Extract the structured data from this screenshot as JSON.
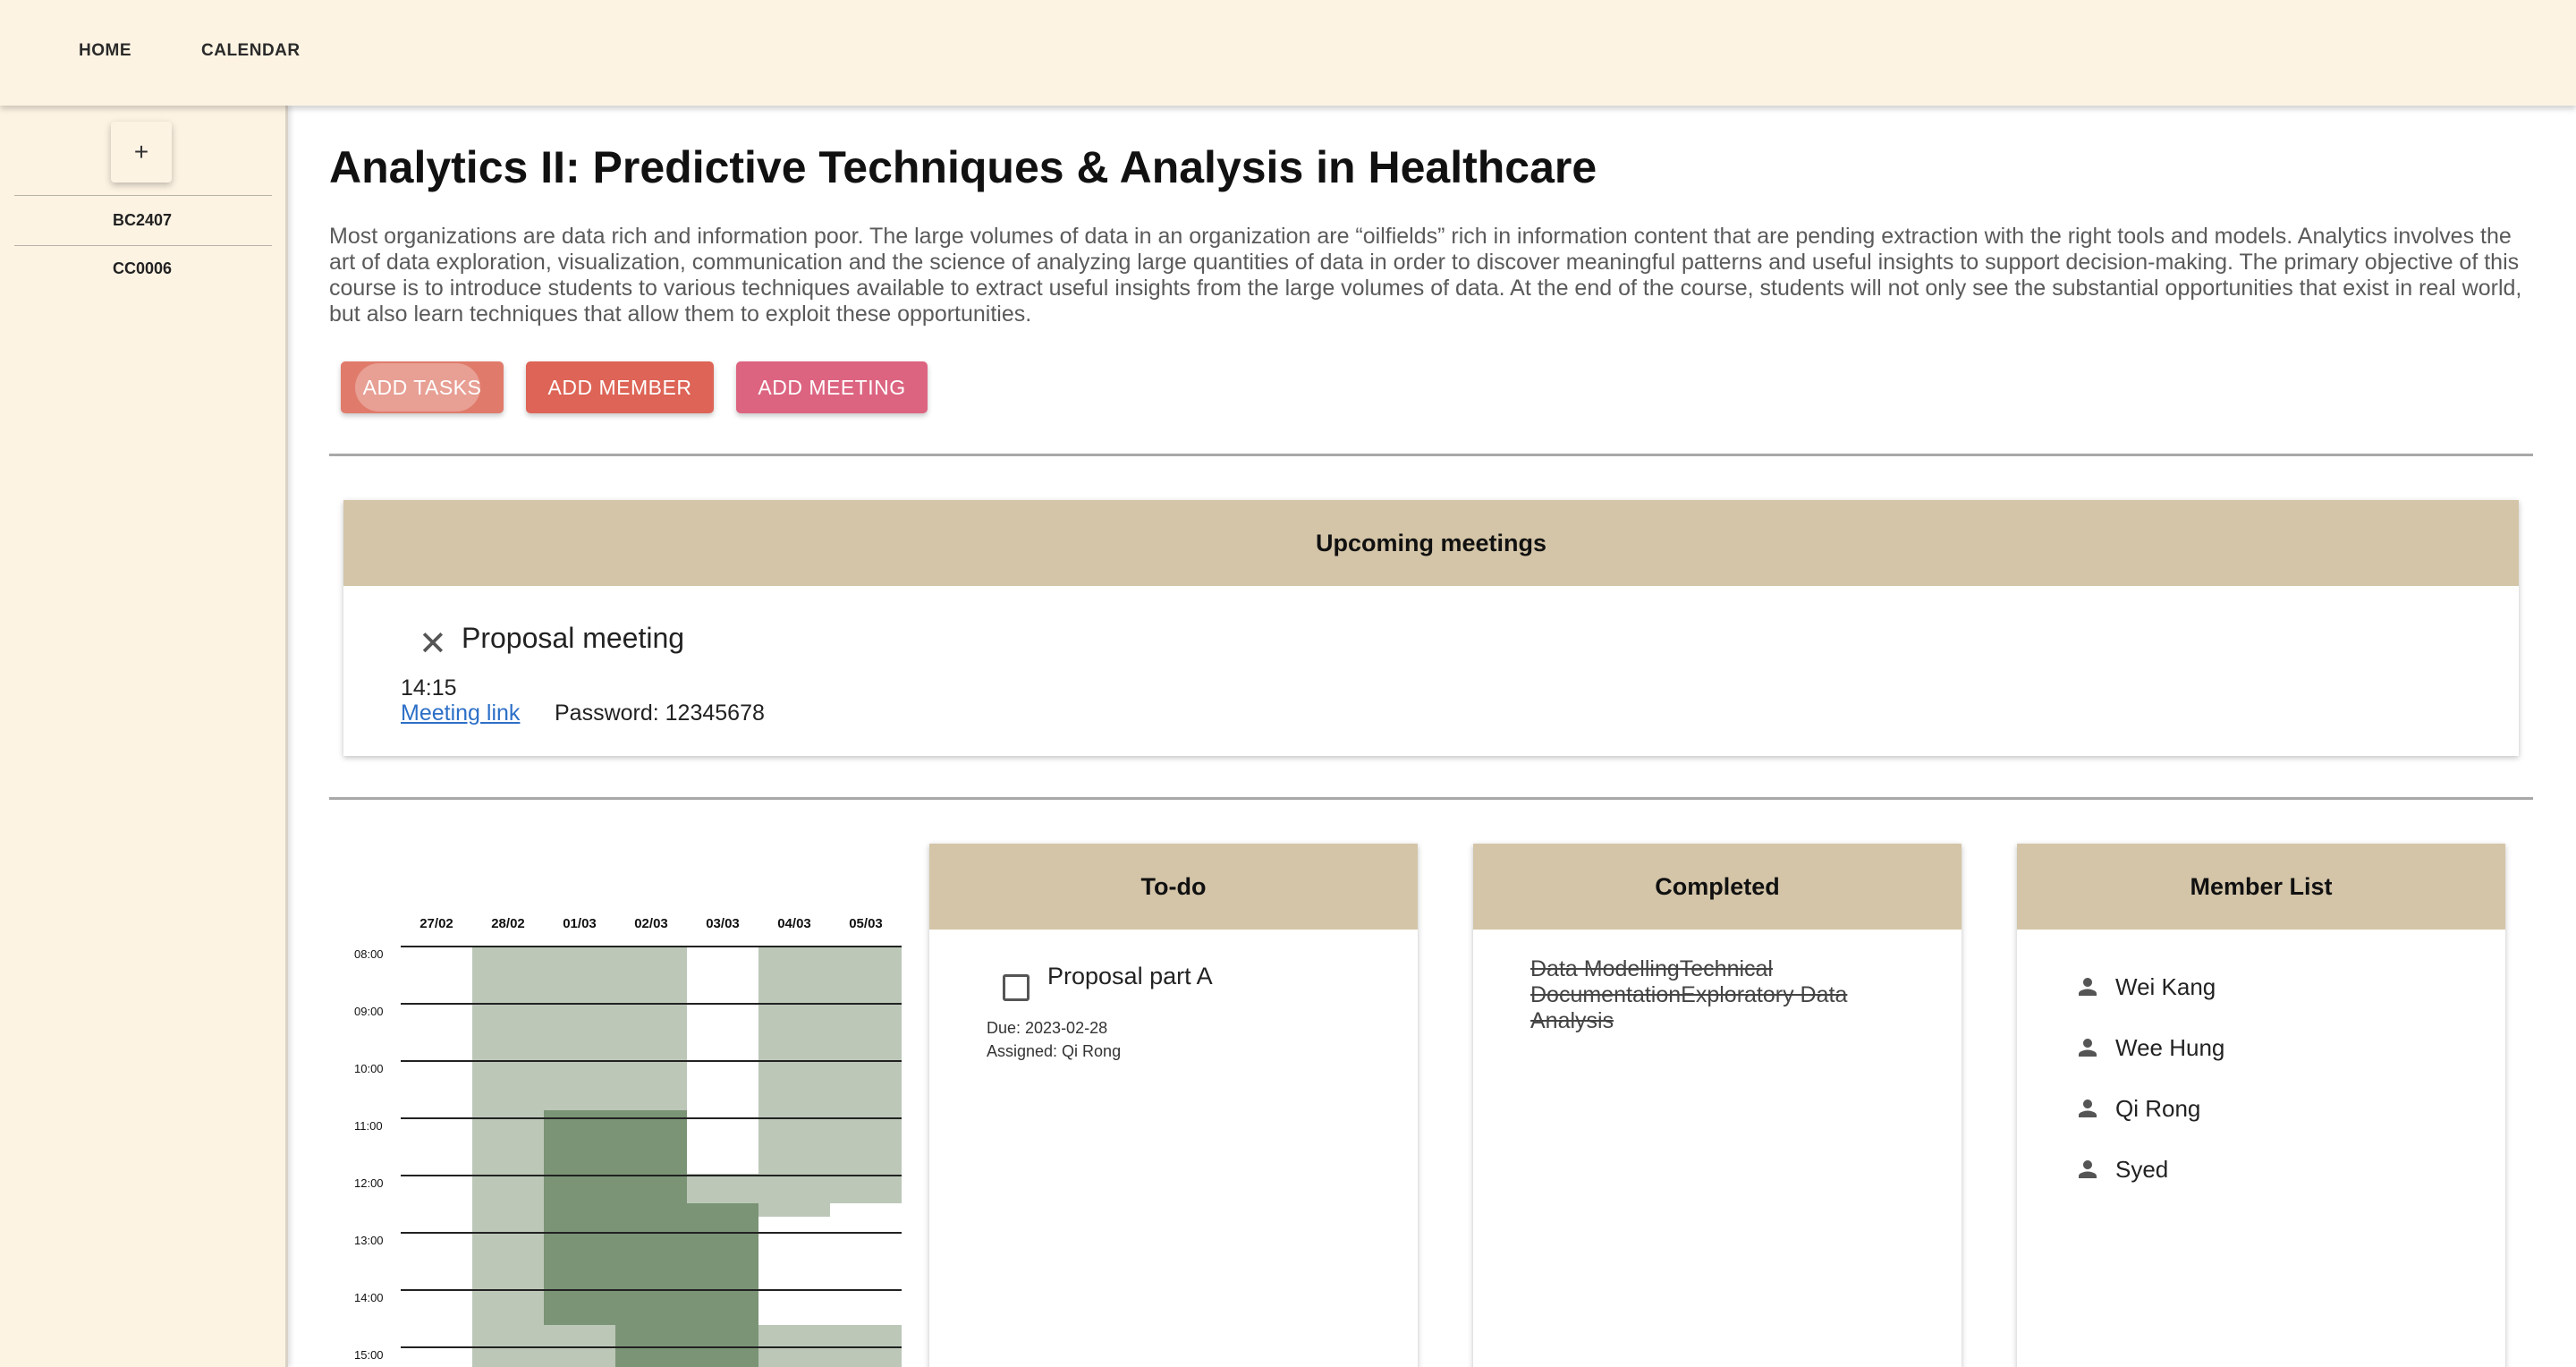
{
  "nav": {
    "home": "HOME",
    "calendar": "CALENDAR"
  },
  "sidebar": {
    "add_label": "+",
    "items": [
      {
        "label": "BC2407"
      },
      {
        "label": "CC0006"
      }
    ]
  },
  "course": {
    "title": "Analytics II: Predictive Techniques & Analysis in Healthcare",
    "description": "Most organizations are data rich and information poor. The large volumes of data in an organization are “oilfields” rich in information content that are pending extraction with the right tools and models. Analytics involves the art of data exploration, visualization, communication and the science of analyzing large quantities of data in order to discover meaningful patterns and useful insights to support decision-making. The primary objective of this course is to introduce students to various techniques available to extract useful insights from the large volumes of data. At the end of the course, students will not only see the substantial opportunities that exist in real world, but also learn techniques that allow them to exploit these opportunities."
  },
  "actions": {
    "add_tasks": "ADD TASKS",
    "add_member": "ADD MEMBER",
    "add_meeting": "ADD MEETING"
  },
  "meetings": {
    "header": "Upcoming meetings",
    "items": [
      {
        "name": "Proposal meeting",
        "time": "14:15",
        "link_label": "Meeting link",
        "password": "Password: 12345678"
      }
    ]
  },
  "schedule": {
    "days": [
      "27/02",
      "28/02",
      "01/03",
      "02/03",
      "03/03",
      "04/03",
      "05/03"
    ],
    "times": [
      "08:00",
      "09:00",
      "10:00",
      "11:00",
      "12:00",
      "13:00",
      "14:00",
      "15:00"
    ],
    "colors": {
      "light": "#bcc7b8",
      "dark": "#7a9475"
    }
  },
  "todo": {
    "header": "To-do",
    "items": [
      {
        "name": "Proposal part A",
        "due": "Due: 2023-02-28",
        "assigned": "Assigned: Qi Rong"
      }
    ]
  },
  "completed": {
    "header": "Completed",
    "text": "Data ModellingTechnical DocumentationExploratory Data Analysis"
  },
  "members": {
    "header": "Member List",
    "icon": "person-icon",
    "items": [
      {
        "name": "Wei Kang"
      },
      {
        "name": "Wee Hung"
      },
      {
        "name": "Qi Rong"
      },
      {
        "name": "Syed"
      }
    ]
  },
  "colors": {
    "background_cream": "#fdf3e3",
    "card_header": "#d4c5a8",
    "add_tasks": "#e07b6b",
    "add_member": "#dd6456",
    "add_meeting": "#dc6480",
    "link": "#2c6fc7"
  }
}
